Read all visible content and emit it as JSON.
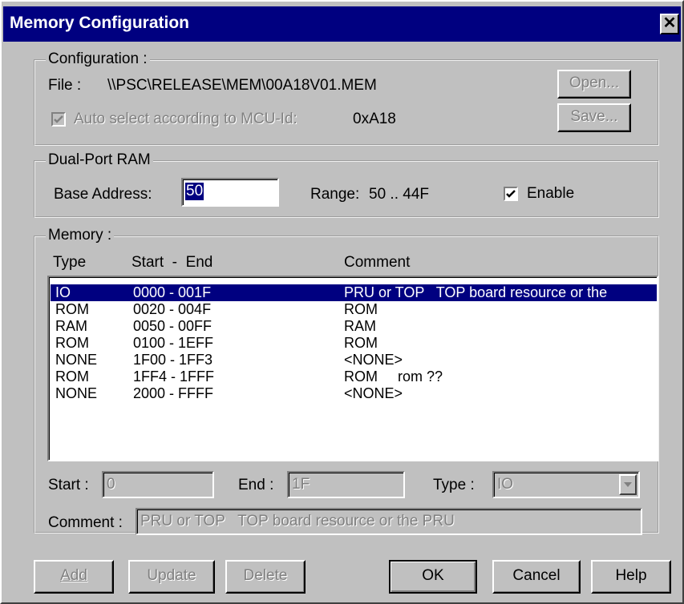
{
  "window": {
    "title": "Memory Configuration",
    "close_glyph": "✕"
  },
  "configuration": {
    "group_label": "Configuration :",
    "file_label": "File :",
    "file_path": "\\\\PSC\\RELEASE\\MEM\\00A18V01.MEM",
    "auto_select_label": "Auto select according to MCU-Id:",
    "auto_select_checked": true,
    "mcu_id": "0xA18",
    "open_button": "Open...",
    "save_button": "Save..."
  },
  "dual_port_ram": {
    "group_label": "Dual-Port RAM",
    "base_address_label": "Base Address:",
    "base_address_value": "50",
    "range_label": "Range:",
    "range_value": "50 .. 44F",
    "enable_label": "Enable",
    "enable_checked": true
  },
  "memory": {
    "group_label": "Memory :",
    "columns": {
      "type": "Type",
      "start_end": "Start  -  End",
      "comment": "Comment"
    },
    "rows": [
      {
        "type": "IO",
        "range": "0000 - 001F",
        "comment": "PRU or TOP   TOP board resource or the",
        "selected": true
      },
      {
        "type": "ROM",
        "range": "0020 - 004F",
        "comment": "ROM",
        "selected": false
      },
      {
        "type": "RAM",
        "range": "0050 - 00FF",
        "comment": "RAM",
        "selected": false
      },
      {
        "type": "ROM",
        "range": "0100 - 1EFF",
        "comment": "ROM",
        "selected": false
      },
      {
        "type": "NONE",
        "range": "1F00 - 1FF3",
        "comment": "<NONE>",
        "selected": false
      },
      {
        "type": "ROM",
        "range": "1FF4 - 1FFF",
        "comment": "ROM     rom ??",
        "selected": false
      },
      {
        "type": "NONE",
        "range": "2000 - FFFF",
        "comment": "<NONE>",
        "selected": false
      }
    ],
    "start_label": "Start :",
    "start_value": "0",
    "end_label": "End :",
    "end_value": "1F",
    "type_label": "Type :",
    "type_value": "IO",
    "comment_label": "Comment :",
    "comment_value": "PRU or TOP   TOP board resource or the PRU"
  },
  "buttons": {
    "add": "Add",
    "update": "Update",
    "delete": "Delete",
    "ok": "OK",
    "cancel": "Cancel",
    "help": "Help"
  },
  "icons": {
    "close": "close-icon",
    "check": "checkmark-icon",
    "dropdown": "chevron-down-icon"
  }
}
